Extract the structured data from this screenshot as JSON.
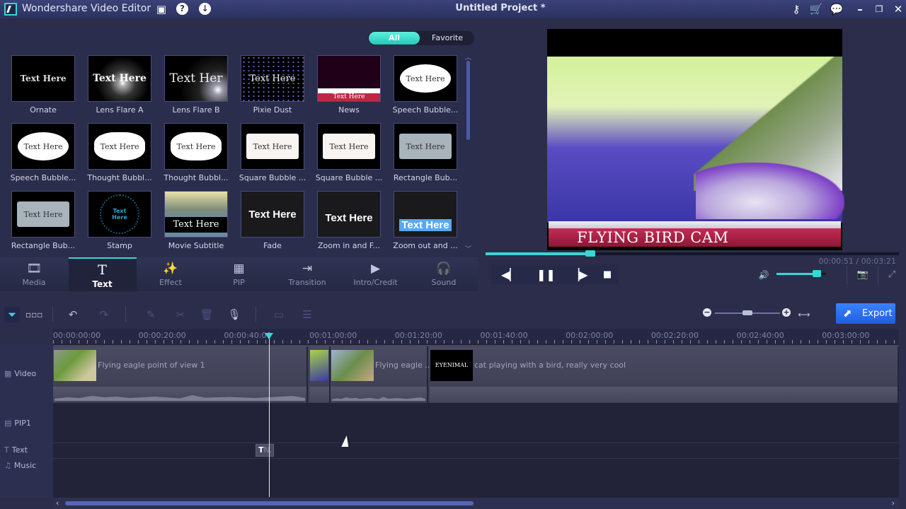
{
  "titlebar": {
    "app_title": "Wondershare Video Editor",
    "project_title": "Untitled Project *",
    "icons": [
      "save-icon",
      "help-icon",
      "download-icon",
      "key-icon",
      "cart-icon",
      "chat-icon",
      "minimize-icon",
      "restore-icon",
      "close-icon"
    ]
  },
  "library": {
    "filters": {
      "all": "All",
      "favorite": "Favorite",
      "selected": "All"
    },
    "items": [
      {
        "label": "Ornate",
        "thumb_text": "Text Here"
      },
      {
        "label": "Lens Flare A",
        "thumb_text": "Text Here"
      },
      {
        "label": "Lens Flare B",
        "thumb_text": "Text Her"
      },
      {
        "label": "Pixie Dust",
        "thumb_text": "Text Here"
      },
      {
        "label": "News",
        "thumb_text": "Text Here"
      },
      {
        "label": "Speech Bubble...",
        "thumb_text": "Text Here"
      },
      {
        "label": "Speech Bubble...",
        "thumb_text": "Text Here"
      },
      {
        "label": "Thought Bubbl...",
        "thumb_text": "Text Here"
      },
      {
        "label": "Thought Bubbl...",
        "thumb_text": "Text Here"
      },
      {
        "label": "Square Bubble ...",
        "thumb_text": "Text Here"
      },
      {
        "label": "Square Bubble ...",
        "thumb_text": "Text Here"
      },
      {
        "label": "Rectangle Bub...",
        "thumb_text": "Text Here"
      },
      {
        "label": "Rectangle Bub...",
        "thumb_text": "Text Here"
      },
      {
        "label": "Stamp",
        "thumb_text": "Text Here"
      },
      {
        "label": "Movie Subtitle",
        "thumb_text": "Text Here"
      },
      {
        "label": "Fade",
        "thumb_text": "Text Here"
      },
      {
        "label": "Zoom in and F...",
        "thumb_text": "Text Here"
      },
      {
        "label": "Zoom out and ...",
        "thumb_text": "Text Here"
      }
    ]
  },
  "tabs": [
    {
      "label": "Media",
      "icon": "media-icon",
      "glyph": "🎞"
    },
    {
      "label": "Text",
      "icon": "text-icon",
      "glyph": "T",
      "active": true
    },
    {
      "label": "Effect",
      "icon": "magic-wand-icon",
      "glyph": "✨"
    },
    {
      "label": "PIP",
      "icon": "pip-icon",
      "glyph": "▦"
    },
    {
      "label": "Transition",
      "icon": "transition-icon",
      "glyph": "⇥"
    },
    {
      "label": "Intro/Credit",
      "icon": "clapper-icon",
      "glyph": "▶"
    },
    {
      "label": "Sound",
      "icon": "headphones-icon",
      "glyph": "🎧"
    }
  ],
  "preview": {
    "overlay_title": "FLYING BIRD CAM",
    "time_current": "00:00:51",
    "time_total": "00:03:21",
    "time_display": "00:00:51 / 00:03:21",
    "progress": 0.254,
    "volume": 0.82
  },
  "timeline_toolbar": {
    "export_label": "Export",
    "zoom_level": 0.5
  },
  "ruler": {
    "labels": [
      "00:00:00:00",
      "00:00:20:00",
      "00:00:40:00",
      "00:01:00:00",
      "00:01:20:00",
      "00:01:40:00",
      "00:02:00:00",
      "00:02:20:00",
      "00:02:40:00",
      "00:03:00:00"
    ]
  },
  "tracks": {
    "labels": {
      "video": "Video",
      "pip": "PIP1",
      "text": "Text",
      "music": "Music"
    },
    "video_clips": [
      {
        "name": "Flying eagle point of view 1"
      },
      {
        "name": ""
      },
      {
        "name": "Flying eagle ..."
      },
      {
        "name": "cat playing with a bird, really very cool",
        "thumb_text": "EYENIMAL"
      }
    ],
    "text_clip": {
      "glyph": "T",
      "name": "N."
    }
  },
  "colors": {
    "accent": "#3ad6d6",
    "export": "#2a6ff0",
    "background": "#2b2d4a"
  }
}
